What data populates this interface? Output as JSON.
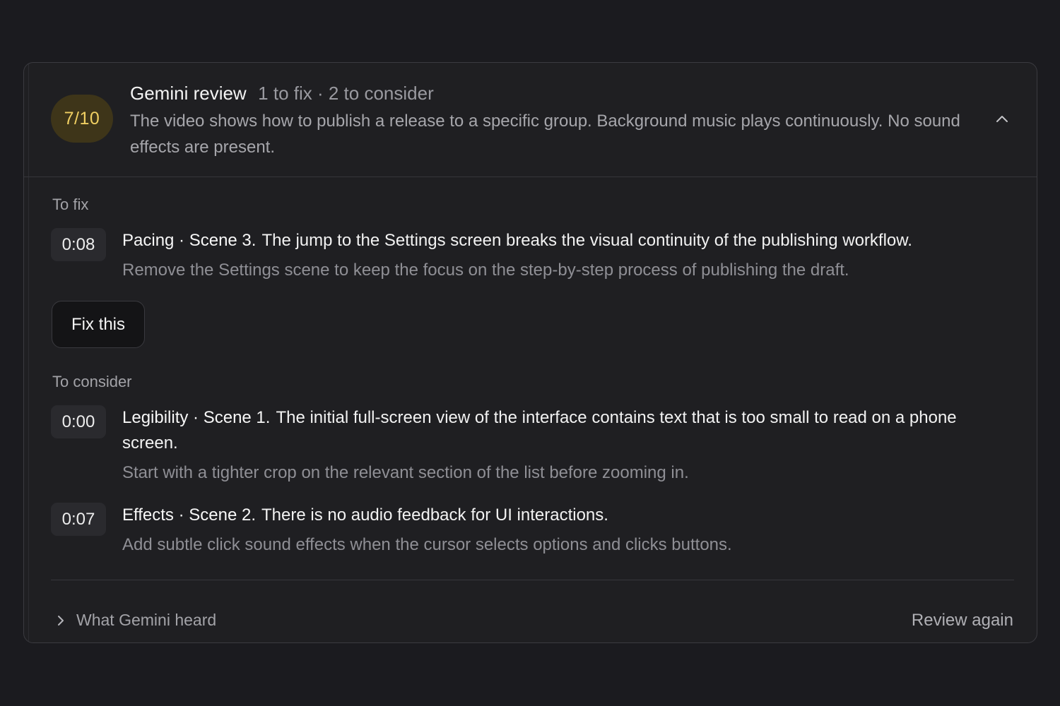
{
  "review": {
    "score": "7/10",
    "title": "Gemini review",
    "counts": "1 to fix · 2 to consider",
    "summary": "The video shows how to publish a release to a specific group. Background music plays continuously. No sound effects are present.",
    "collapse_icon": "chevron-up-icon"
  },
  "to_fix": {
    "label": "To fix",
    "items": [
      {
        "time": "0:08",
        "tag": "Pacing · Scene 3.",
        "issue": "The jump to the Settings screen breaks the visual continuity of the publishing workflow.",
        "suggestion": "Remove the Settings scene to keep the focus on the step-by-step process of publishing the draft."
      }
    ],
    "fix_button": "Fix this"
  },
  "to_consider": {
    "label": "To consider",
    "items": [
      {
        "time": "0:00",
        "tag": "Legibility · Scene 1.",
        "issue": "The initial full-screen view of the interface contains text that is too small to read on a phone screen.",
        "suggestion": "Start with a tighter crop on the relevant section of the list before zooming in."
      },
      {
        "time": "0:07",
        "tag": "Effects · Scene 2.",
        "issue": "There is no audio feedback for UI interactions.",
        "suggestion": "Add subtle click sound effects when the cursor selects options and clicks buttons."
      }
    ]
  },
  "footer": {
    "heard_label": "What Gemini heard",
    "heard_icon": "chevron-right-icon",
    "review_again": "Review again"
  }
}
